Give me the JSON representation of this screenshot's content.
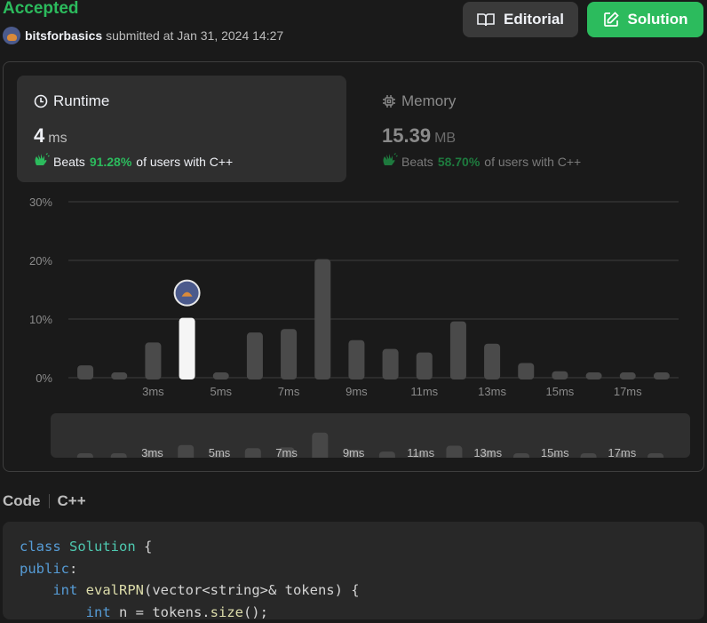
{
  "header": {
    "status": "Accepted",
    "username": "bitsforbasics",
    "submitted_text": "submitted at Jan 31, 2024 14:27",
    "editorial_label": "Editorial",
    "solution_label": "Solution"
  },
  "runtime": {
    "title": "Runtime",
    "value": "4",
    "unit": "ms",
    "beats_label": "Beats",
    "beats_pct": "91.28%",
    "beats_suffix": "of users with C++"
  },
  "memory": {
    "title": "Memory",
    "value": "15.39",
    "unit": "MB",
    "beats_label": "Beats",
    "beats_pct": "58.70%",
    "beats_suffix": "of users with C++"
  },
  "colors": {
    "accent_green": "#2cbb5d",
    "bar": "#4a4a4a",
    "bar_selected": "#f5f5f5",
    "background": "#1a1a1a"
  },
  "chart_data": {
    "type": "bar",
    "y_ticks": [
      "0%",
      "10%",
      "20%",
      "30%"
    ],
    "ylim": [
      0,
      30
    ],
    "x_tick_labels": [
      "3ms",
      "5ms",
      "7ms",
      "9ms",
      "11ms",
      "13ms",
      "15ms",
      "17ms"
    ],
    "categories": [
      "1ms",
      "2ms",
      "3ms",
      "4ms",
      "5ms",
      "6ms",
      "7ms",
      "8ms",
      "9ms",
      "10ms",
      "11ms",
      "12ms",
      "13ms",
      "14ms",
      "15ms",
      "16ms",
      "17ms",
      "18ms"
    ],
    "values": [
      2.1,
      0.9,
      6.0,
      10.2,
      0.9,
      7.7,
      8.3,
      20.2,
      6.4,
      4.9,
      4.3,
      9.6,
      5.8,
      2.5,
      1.1,
      0.9,
      0.9,
      0.9
    ],
    "selected_category": "4ms",
    "grid": true
  },
  "code": {
    "section_label": "Code",
    "language": "C++",
    "lines": [
      [
        {
          "t": "class",
          "c": "kw"
        },
        {
          "t": " ",
          "c": "pl"
        },
        {
          "t": "Solution",
          "c": "ty"
        },
        {
          "t": " {",
          "c": "pl"
        }
      ],
      [
        {
          "t": "public",
          "c": "kw"
        },
        {
          "t": ":",
          "c": "pl"
        }
      ],
      [
        {
          "t": "    ",
          "c": "pl"
        },
        {
          "t": "int",
          "c": "kw"
        },
        {
          "t": " ",
          "c": "pl"
        },
        {
          "t": "evalRPN",
          "c": "fn"
        },
        {
          "t": "(vector<string>& tokens) {",
          "c": "pl"
        }
      ],
      [
        {
          "t": "        ",
          "c": "pl"
        },
        {
          "t": "int",
          "c": "kw"
        },
        {
          "t": " n = tokens.",
          "c": "pl"
        },
        {
          "t": "size",
          "c": "fn"
        },
        {
          "t": "();",
          "c": "pl"
        }
      ]
    ]
  }
}
